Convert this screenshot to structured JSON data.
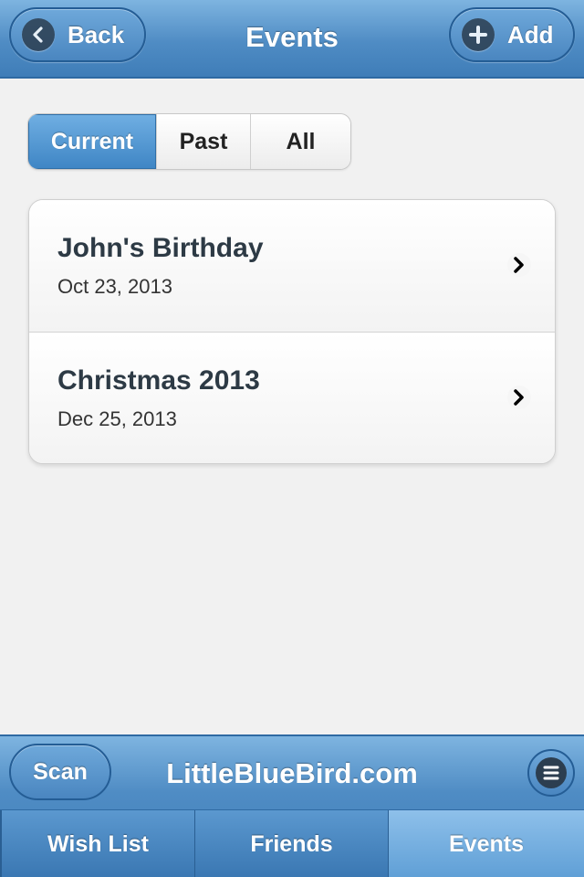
{
  "header": {
    "title": "Events",
    "back_label": "Back",
    "add_label": "Add"
  },
  "filter": {
    "options": [
      {
        "label": "Current",
        "selected": true
      },
      {
        "label": "Past",
        "selected": false
      },
      {
        "label": "All",
        "selected": false
      }
    ]
  },
  "events": [
    {
      "title": "John's Birthday",
      "date": "Oct 23, 2013"
    },
    {
      "title": "Christmas 2013",
      "date": "Dec 25, 2013"
    }
  ],
  "footer": {
    "scan_label": "Scan",
    "brand": "LittleBlueBird.com",
    "menu_icon": "menu-icon"
  },
  "tabs": [
    {
      "label": "Wish List",
      "active": false
    },
    {
      "label": "Friends",
      "active": false
    },
    {
      "label": "Events",
      "active": true
    }
  ],
  "colors": {
    "accent": "#4f8cc4",
    "accent_dark": "#245d95",
    "text_dark": "#2d3a45"
  }
}
